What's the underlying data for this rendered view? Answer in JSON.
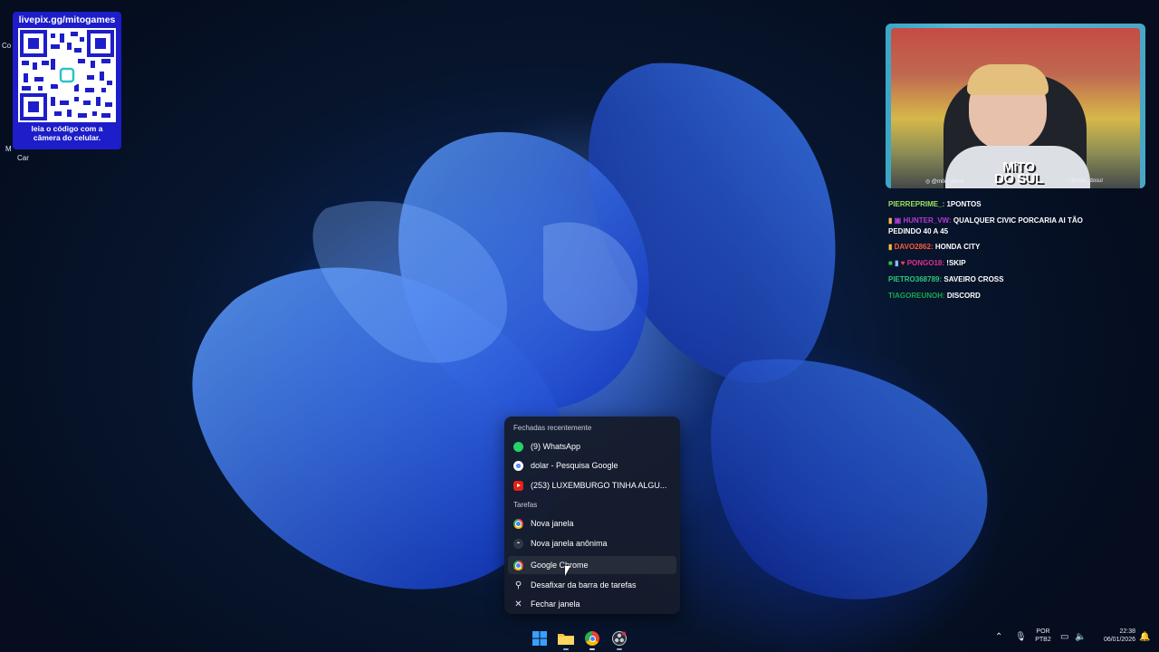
{
  "desktop": {
    "icon_fragments": [
      "Co",
      "M",
      "Car"
    ]
  },
  "overlay_qr": {
    "url": "livepix.gg/mitogames",
    "caption": "leia o código com a câmera do celular."
  },
  "webcam": {
    "logo_line1": "MiTO",
    "logo_line2": "DO SUL",
    "handle_left": "@mito_dosul",
    "handle_right": "@mito_dosul"
  },
  "chat": {
    "messages": [
      {
        "user": "PIERREPRIME_:",
        "text": "1PONTOS",
        "color": "#9be35a"
      },
      {
        "user": "HUNTER_VW:",
        "text": "QUALQUER CIVIC PORCARIA AI TÃO PEDINDO 40 A 45",
        "color": "#b33bd6"
      },
      {
        "user": "DAVO2862:",
        "text": "HONDA CITY",
        "color": "#ff5a3c"
      },
      {
        "user": "PONGO18:",
        "text": "!SKIP",
        "color": "#e0308a"
      },
      {
        "user": "PIETRO368789:",
        "text": "SAVEIRO CROSS",
        "color": "#2fc77a"
      },
      {
        "user": "TIAGOREUNOH:",
        "text": "DISCORD",
        "color": "#18a84a"
      }
    ]
  },
  "jumplist": {
    "section_recent": "Fechadas recentemente",
    "recent": [
      {
        "label": "(9) WhatsApp",
        "icon": "whatsapp-icon"
      },
      {
        "label": "dolar - Pesquisa Google",
        "icon": "google-icon"
      },
      {
        "label": "(253) LUXEMBURGO TINHA ALGU...",
        "icon": "youtube-icon"
      }
    ],
    "section_tasks": "Tarefas",
    "tasks": [
      {
        "label": "Nova janela",
        "icon": "chrome-icon"
      },
      {
        "label": "Nova janela anônima",
        "icon": "incognito-icon"
      }
    ],
    "app": {
      "label": "Google Chrome",
      "icon": "chrome-icon"
    },
    "unpin": {
      "label": "Desafixar da barra de tarefas",
      "icon": "unpin-icon"
    },
    "close": {
      "label": "Fechar janela",
      "icon": "close-icon"
    }
  },
  "taskbar": {
    "apps": [
      "start-icon",
      "file-explorer-icon",
      "chrome-icon",
      "obs-icon"
    ],
    "language_line1": "POR",
    "language_line2": "PTB2",
    "time": "22:38",
    "date": "06/01/2026"
  }
}
